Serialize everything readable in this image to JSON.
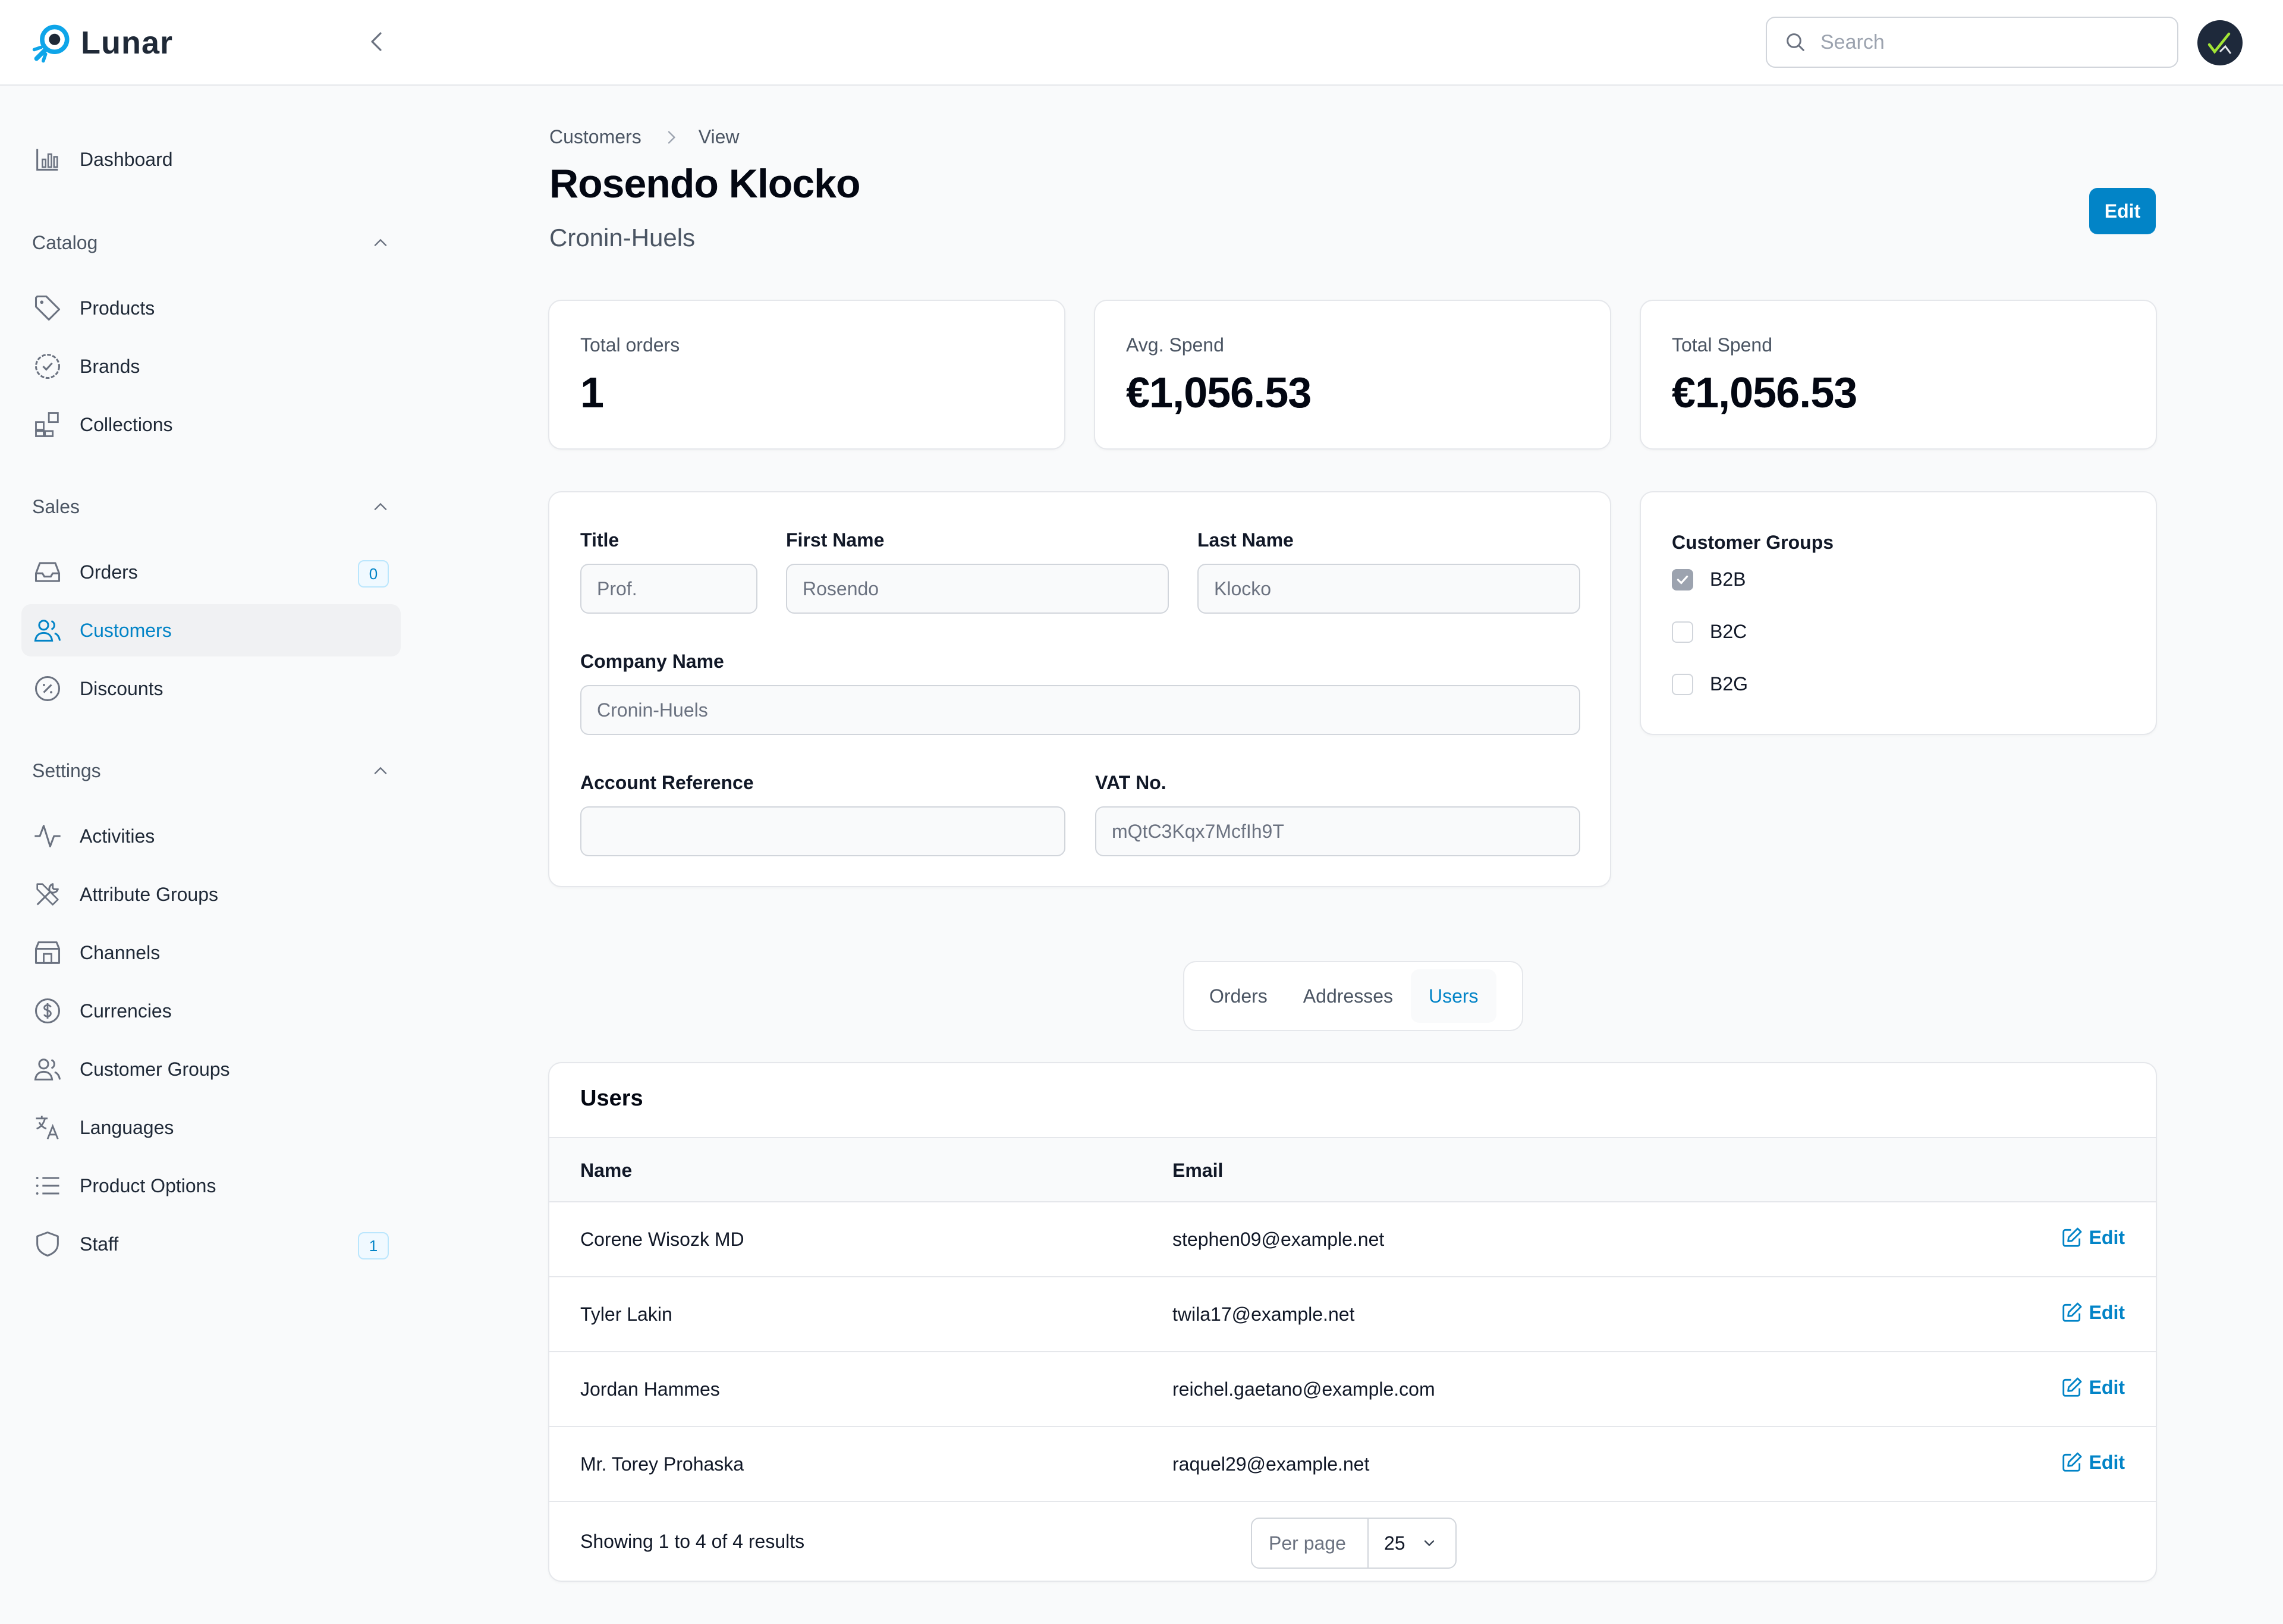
{
  "app": {
    "name": "Lunar",
    "search_placeholder": "Search"
  },
  "sidebar": {
    "dashboard": {
      "label": "Dashboard",
      "icon": "chart-bar-icon"
    },
    "groups": [
      {
        "label": "Catalog",
        "items": [
          {
            "label": "Products",
            "icon": "tag-icon"
          },
          {
            "label": "Brands",
            "icon": "badge-check-icon"
          },
          {
            "label": "Collections",
            "icon": "squares-plus-icon"
          }
        ]
      },
      {
        "label": "Sales",
        "items": [
          {
            "label": "Orders",
            "icon": "inbox-icon",
            "badge": "0"
          },
          {
            "label": "Customers",
            "icon": "users-icon",
            "active": true
          },
          {
            "label": "Discounts",
            "icon": "receipt-percent-icon"
          }
        ]
      },
      {
        "label": "Settings",
        "items": [
          {
            "label": "Activities",
            "icon": "activity-icon"
          },
          {
            "label": "Attribute Groups",
            "icon": "wrench-screwdriver-icon"
          },
          {
            "label": "Channels",
            "icon": "storefront-icon"
          },
          {
            "label": "Currencies",
            "icon": "currency-dollar-icon"
          },
          {
            "label": "Customer Groups",
            "icon": "user-group-icon"
          },
          {
            "label": "Languages",
            "icon": "language-icon"
          },
          {
            "label": "Product Options",
            "icon": "list-icon"
          },
          {
            "label": "Staff",
            "icon": "shield-icon",
            "badge": "1"
          }
        ]
      }
    ]
  },
  "breadcrumb": [
    "Customers",
    "View"
  ],
  "page": {
    "title": "Rosendo Klocko",
    "subtitle": "Cronin-Huels",
    "edit_label": "Edit"
  },
  "stats": [
    {
      "label": "Total orders",
      "value": "1"
    },
    {
      "label": "Avg. Spend",
      "value": "€1,056.53"
    },
    {
      "label": "Total Spend",
      "value": "€1,056.53"
    }
  ],
  "form": {
    "title": {
      "label": "Title",
      "value": "Prof."
    },
    "first_name": {
      "label": "First Name",
      "value": "Rosendo"
    },
    "last_name": {
      "label": "Last Name",
      "value": "Klocko"
    },
    "company_name": {
      "label": "Company Name",
      "value": "Cronin-Huels"
    },
    "account_reference": {
      "label": "Account Reference",
      "value": ""
    },
    "vat_no": {
      "label": "VAT No.",
      "value": "mQtC3Kqx7McfIh9T"
    }
  },
  "customer_groups": {
    "title": "Customer Groups",
    "options": [
      {
        "label": "B2B",
        "checked": true
      },
      {
        "label": "B2C",
        "checked": false
      },
      {
        "label": "B2G",
        "checked": false
      }
    ]
  },
  "tabs": [
    {
      "label": "Orders",
      "active": false
    },
    {
      "label": "Addresses",
      "active": false
    },
    {
      "label": "Users",
      "active": true
    }
  ],
  "users_table": {
    "title": "Users",
    "columns": [
      "Name",
      "Email"
    ],
    "edit_label": "Edit",
    "rows": [
      {
        "name": "Corene Wisozk MD",
        "email": "stephen09@example.net"
      },
      {
        "name": "Tyler Lakin",
        "email": "twila17@example.net"
      },
      {
        "name": "Jordan Hammes",
        "email": "reichel.gaetano@example.com"
      },
      {
        "name": "Mr. Torey Prohaska",
        "email": "raquel29@example.net"
      }
    ],
    "summary": "Showing 1 to 4 of 4 results",
    "per_page_label": "Per page",
    "per_page_value": "25"
  },
  "colors": {
    "accent": "#0284c7",
    "background": "#f9fafb",
    "border": "#e5e7eb"
  }
}
